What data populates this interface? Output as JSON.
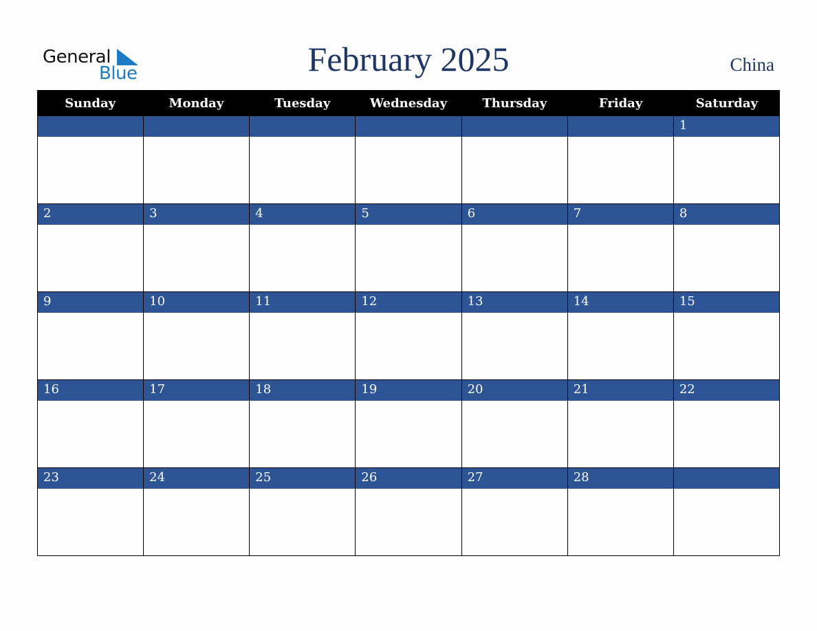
{
  "logo": {
    "line1": "General",
    "line2": "Blue",
    "accent_color": "#1c7bc4"
  },
  "header": {
    "title": "February 2025",
    "country": "China"
  },
  "colors": {
    "date_bar": "#2d5595",
    "title": "#1e3666",
    "weekday_header_bg": "#000000"
  },
  "weekdays": [
    "Sunday",
    "Monday",
    "Tuesday",
    "Wednesday",
    "Thursday",
    "Friday",
    "Saturday"
  ],
  "weeks": [
    [
      "",
      "",
      "",
      "",
      "",
      "",
      "1"
    ],
    [
      "2",
      "3",
      "4",
      "5",
      "6",
      "7",
      "8"
    ],
    [
      "9",
      "10",
      "11",
      "12",
      "13",
      "14",
      "15"
    ],
    [
      "16",
      "17",
      "18",
      "19",
      "20",
      "21",
      "22"
    ],
    [
      "23",
      "24",
      "25",
      "26",
      "27",
      "28",
      ""
    ]
  ]
}
